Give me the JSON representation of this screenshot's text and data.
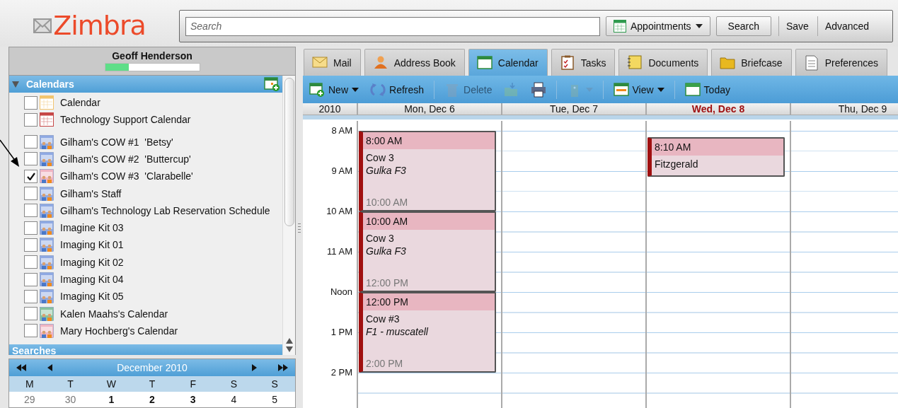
{
  "logo": {
    "text": "Zimbra"
  },
  "search": {
    "placeholder": "Search",
    "type_button": "Appointments",
    "buttons": [
      "Search",
      "Save",
      "Advanced"
    ]
  },
  "user": {
    "name": "Geoff Henderson",
    "quota": {
      "level": 0.25
    }
  },
  "calendars": {
    "title": "Calendars",
    "expanded": true,
    "groups": [
      [
        {
          "label": "Calendar",
          "checked": false,
          "kind": "calendar",
          "color": "#f2c46e"
        },
        {
          "label": "Technology Support Calendar",
          "checked": false,
          "kind": "calendar",
          "color": "#c64646"
        }
      ],
      [
        {
          "label": "Gilham's COW #1  'Betsy'",
          "checked": false,
          "kind": "shared",
          "color": "#8fa9e3"
        },
        {
          "label": "Gilham's COW #2  'Buttercup'",
          "checked": false,
          "kind": "shared",
          "color": "#8fa9e3"
        },
        {
          "label": "Gilham's COW #3  'Clarabelle'",
          "checked": true,
          "kind": "shared",
          "color": "#f0b4c2"
        },
        {
          "label": "Gilham's Staff",
          "checked": false,
          "kind": "shared",
          "color": "#8fa9e3"
        },
        {
          "label": "Gilham's Technology Lab Reservation Schedule",
          "checked": false,
          "kind": "shared",
          "color": "#8fa9e3"
        },
        {
          "label": "Imagine Kit 03",
          "checked": false,
          "kind": "shared",
          "color": "#8fa9e3"
        },
        {
          "label": "Imaging Kit 01",
          "checked": false,
          "kind": "shared",
          "color": "#8fa9e3"
        },
        {
          "label": "Imaging Kit 02",
          "checked": false,
          "kind": "shared",
          "color": "#8fa9e3"
        },
        {
          "label": "Imaging Kit 04",
          "checked": false,
          "kind": "shared",
          "color": "#8fa9e3"
        },
        {
          "label": "Imaging Kit 05",
          "checked": false,
          "kind": "shared",
          "color": "#8fa9e3"
        },
        {
          "label": "Kalen Maahs's Calendar",
          "checked": false,
          "kind": "shared",
          "color": "#86c29e"
        },
        {
          "label": "Mary Hochberg's Calendar",
          "checked": false,
          "kind": "shared",
          "color": "#f0b4c2"
        }
      ]
    ]
  },
  "searches": {
    "title": "Searches"
  },
  "mini_calendar": {
    "title": "December 2010",
    "weekdays": [
      "M",
      "T",
      "W",
      "T",
      "F",
      "S",
      "S"
    ],
    "dates": [
      {
        "label": "29",
        "other_month": true,
        "has_events": false
      },
      {
        "label": "30",
        "other_month": true,
        "has_events": false
      },
      {
        "label": "1",
        "other_month": false,
        "has_events": true
      },
      {
        "label": "2",
        "other_month": false,
        "has_events": true
      },
      {
        "label": "3",
        "other_month": false,
        "has_events": true
      },
      {
        "label": "4",
        "other_month": false,
        "has_events": false
      },
      {
        "label": "5",
        "other_month": false,
        "has_events": false
      }
    ]
  },
  "tabs": [
    {
      "label": "Mail",
      "selected": false
    },
    {
      "label": "Address Book",
      "selected": false
    },
    {
      "label": "Calendar",
      "selected": true
    },
    {
      "label": "Tasks",
      "selected": false
    },
    {
      "label": "Documents",
      "selected": false
    },
    {
      "label": "Briefcase",
      "selected": false
    },
    {
      "label": "Preferences",
      "selected": false
    }
  ],
  "toolbar": [
    {
      "kind": "button",
      "label": "New",
      "disabled": false,
      "menu": true
    },
    {
      "kind": "button",
      "label": "Refresh",
      "disabled": false,
      "menu": false
    },
    {
      "kind": "button",
      "label": "Delete",
      "disabled": true,
      "menu": false
    },
    {
      "kind": "icon",
      "disabled": true,
      "menu": false
    },
    {
      "kind": "icon",
      "disabled": false,
      "menu": false
    },
    {
      "kind": "icon",
      "disabled": true,
      "menu": true
    },
    {
      "kind": "button",
      "label": "View",
      "disabled": false,
      "menu": true
    },
    {
      "kind": "button",
      "label": "Today",
      "disabled": false,
      "menu": false
    }
  ],
  "week": {
    "year": "2010",
    "hours": [
      "8 AM",
      "9 AM",
      "10 AM",
      "11 AM",
      "Noon",
      "1 PM",
      "2 PM"
    ],
    "days": [
      {
        "label": "Mon, Dec 6",
        "today": false,
        "events": [
          {
            "start": "8:00 AM",
            "title": "Cow 3",
            "location": "Gulka F3",
            "end": "10:00 AM"
          },
          {
            "start": "10:00 AM",
            "title": "Cow 3",
            "location": "Gulka F3",
            "end": "12:00 PM"
          },
          {
            "start": "12:00 PM",
            "title": "Cow #3",
            "location": "F1 - muscatell",
            "end": "2:00 PM"
          }
        ]
      },
      {
        "label": "Tue, Dec 7",
        "today": false
      },
      {
        "label": "Wed, Dec 8",
        "today": true,
        "events": [
          {
            "start": "8:10 AM",
            "title": "Fitzgerald"
          }
        ]
      },
      {
        "label": "Thu, Dec 9",
        "today": false
      }
    ]
  }
}
